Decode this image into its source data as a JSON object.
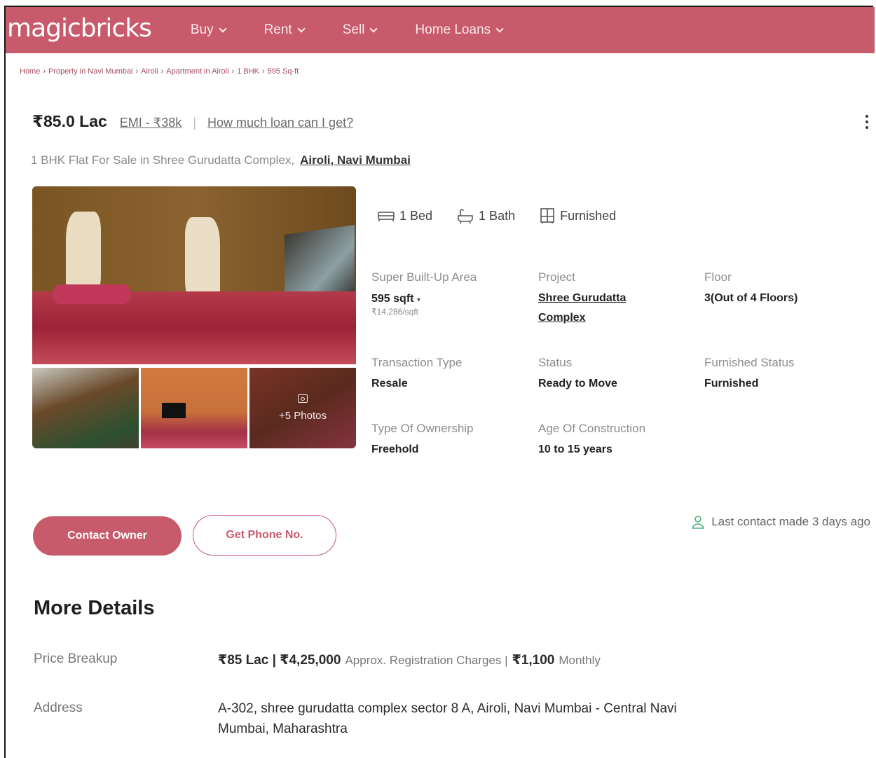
{
  "header": {
    "logo": "magicbricks",
    "nav": [
      {
        "label": "Buy"
      },
      {
        "label": "Rent"
      },
      {
        "label": "Sell"
      },
      {
        "label": "Home Loans"
      }
    ]
  },
  "breadcrumb": [
    "Home",
    "Property in Navi Mumbai",
    "Airoli",
    "Apartment in Airoli",
    "1 BHK",
    "595 Sq-ft"
  ],
  "listing": {
    "price": "₹85.0 Lac",
    "emi": "EMI - ₹38k",
    "loan_link": "How much loan can I get?",
    "title": "1 BHK Flat For Sale in Shree Gurudatta Complex,",
    "location": "Airoli, Navi Mumbai",
    "more_photos": "+5 Photos"
  },
  "amenities": {
    "bed": "1 Bed",
    "bath": "1 Bath",
    "furnished": "Furnished"
  },
  "specs": {
    "area_label": "Super Built-Up Area",
    "area_value": "595 sqft",
    "area_rate": "₹14,286/sqft",
    "project_label": "Project",
    "project_value_1": "Shree Gurudatta",
    "project_value_2": "Complex",
    "floor_label": "Floor",
    "floor_value": "3(Out of 4 Floors)",
    "transaction_label": "Transaction Type",
    "transaction_value": "Resale",
    "status_label": "Status",
    "status_value": "Ready to Move",
    "furnished_label": "Furnished Status",
    "furnished_value": "Furnished",
    "ownership_label": "Type Of Ownership",
    "ownership_value": "Freehold",
    "age_label": "Age Of Construction",
    "age_value": "10 to 15 years"
  },
  "actions": {
    "contact_owner": "Contact Owner",
    "get_phone": "Get Phone No.",
    "last_contact": "Last contact made 3 days ago"
  },
  "more_details": {
    "title": "More Details",
    "price_breakup_label": "Price Breakup",
    "price_part1": "₹85 Lac |",
    "price_part2": "₹4,25,000",
    "price_part2_note": "Approx. Registration Charges |",
    "price_part3": "₹1,100",
    "price_part3_note": "Monthly",
    "address_label": "Address",
    "address_line1": "A-302, shree gurudatta complex sector 8 A, Airoli, Navi Mumbai - Central Navi",
    "address_line2": "Mumbai, Maharashtra"
  },
  "colors": {
    "brand": "#c75a6b",
    "breadcrumb": "#a44b5c"
  }
}
